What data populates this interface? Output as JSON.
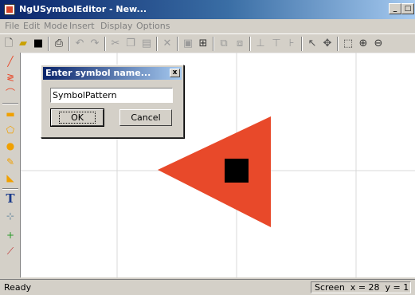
{
  "window": {
    "title": "NgUSymbolEditor - New..."
  },
  "window_buttons": {
    "minimize": "_",
    "maximize": "□",
    "close": "x"
  },
  "menu": [
    "File",
    "Edit",
    "Mode",
    "Insert",
    "Display",
    "Options"
  ],
  "toolbar": {
    "icons": [
      "new-icon",
      "open-icon",
      "save-icon",
      "print-icon",
      "undo-icon",
      "redo-icon",
      "cut-icon",
      "copy-icon",
      "paste-icon",
      "delete-icon",
      "image-icon",
      "image2-icon",
      "group-icon",
      "ungroup-icon",
      "align-icon",
      "align2-icon",
      "align3-icon",
      "select-icon",
      "select-move-icon",
      "zoom-window-icon",
      "zoom-in-icon"
    ]
  },
  "left_tools": {
    "icons": [
      "line-icon",
      "polyline-icon",
      "arc-icon",
      "rectangle-icon",
      "polygon-icon",
      "circle-icon",
      "pencil-icon",
      "fill-icon",
      "text-icon",
      "text-attr-icon",
      "anchor-point-icon",
      "connect-point-icon"
    ],
    "text_tool_label": "T"
  },
  "dialog": {
    "title": "Enter symbol name...",
    "close_label": "x",
    "input_value": "SymbolPattern",
    "ok_label": "OK",
    "cancel_label": "Cancel"
  },
  "canvas": {
    "shapes": [
      {
        "kind": "triangle",
        "color": "#e8492a"
      },
      {
        "kind": "square",
        "color": "#000000"
      }
    ],
    "grid_color": "#d8d8d8"
  },
  "status": {
    "left": "Ready",
    "right": "Screen  x = 28  y = 1"
  },
  "colors": {
    "accent_orange": "#e8492a",
    "title_blue": "#0a246a"
  }
}
